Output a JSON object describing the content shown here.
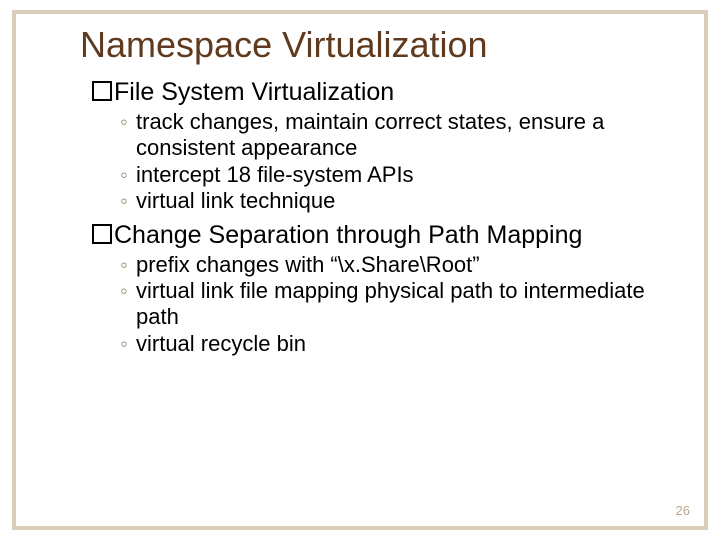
{
  "title": "Namespace Virtualization",
  "sections": [
    {
      "heading": "File System Virtualization",
      "bullets": [
        "track changes, maintain correct states, ensure a consistent appearance",
        "intercept 18 file-system APIs",
        "virtual link technique"
      ]
    },
    {
      "heading": "Change Separation through Path Mapping",
      "bullets": [
        "prefix changes with “\\x.Share\\Root”",
        "virtual link file mapping physical path to intermediate path",
        "virtual recycle bin"
      ]
    }
  ],
  "page_number": "26"
}
